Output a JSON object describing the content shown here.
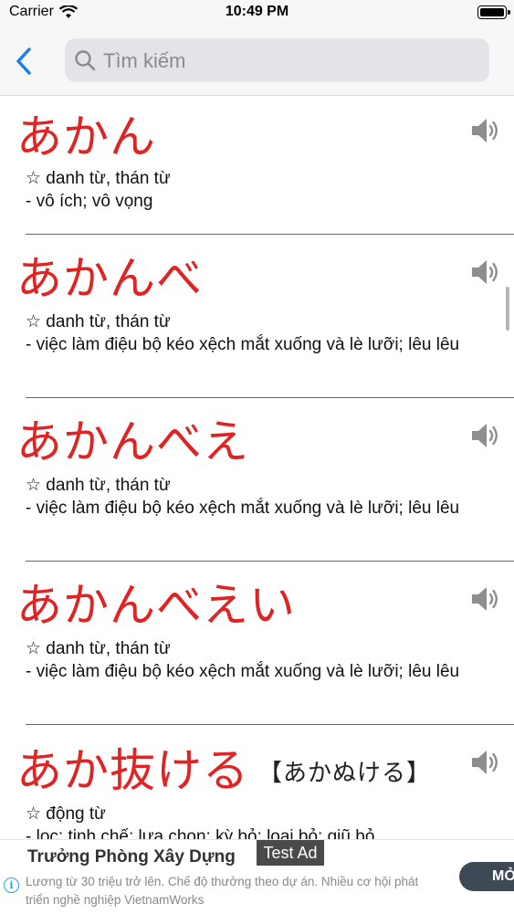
{
  "status_bar": {
    "carrier": "Carrier",
    "time": "10:49 PM"
  },
  "nav": {
    "search_placeholder": "Tìm kiếm",
    "search_value": ""
  },
  "entries": [
    {
      "word": "あかん",
      "reading": "",
      "type": "☆ danh từ, thán từ",
      "definition": "- vô ích; vô vọng"
    },
    {
      "word": "あかんべ",
      "reading": "",
      "type": "☆ danh từ, thán từ",
      "definition": "- việc làm điệu bộ kéo xệch mắt xuống và lè lưỡi; lêu lêu"
    },
    {
      "word": "あかんべえ",
      "reading": "",
      "type": "☆ danh từ, thán từ",
      "definition": "- việc làm điệu bộ kéo xệch mắt xuống và lè lưỡi; lêu lêu"
    },
    {
      "word": "あかんべえい",
      "reading": "",
      "type": "☆ danh từ, thán từ",
      "definition": "- việc làm điệu bộ kéo xệch mắt xuống và lè lưỡi; lêu lêu"
    },
    {
      "word": "あか抜ける",
      "reading": "【あかぬける】",
      "type": "☆ động từ",
      "definition": "- lọc; tinh chế; lựa chọn; kỳ bỏ; loại bỏ; giũ bỏ"
    }
  ],
  "ad": {
    "title": "Trưởng Phòng Xây Dựng",
    "badge": "Test Ad",
    "body": "Lương từ 30 triệu trở lên. Chế độ thưởng theo dự án. Nhiều cơ hội phát triển nghề nghiệp VietnamWorks",
    "cta": "MỞ",
    "info_icon": "i"
  },
  "icons": {
    "back": "chevron-left-icon",
    "search": "magnifier-icon",
    "speaker": "speaker-icon"
  },
  "colors": {
    "word": "#e02323",
    "accent": "#1a7cf5"
  }
}
